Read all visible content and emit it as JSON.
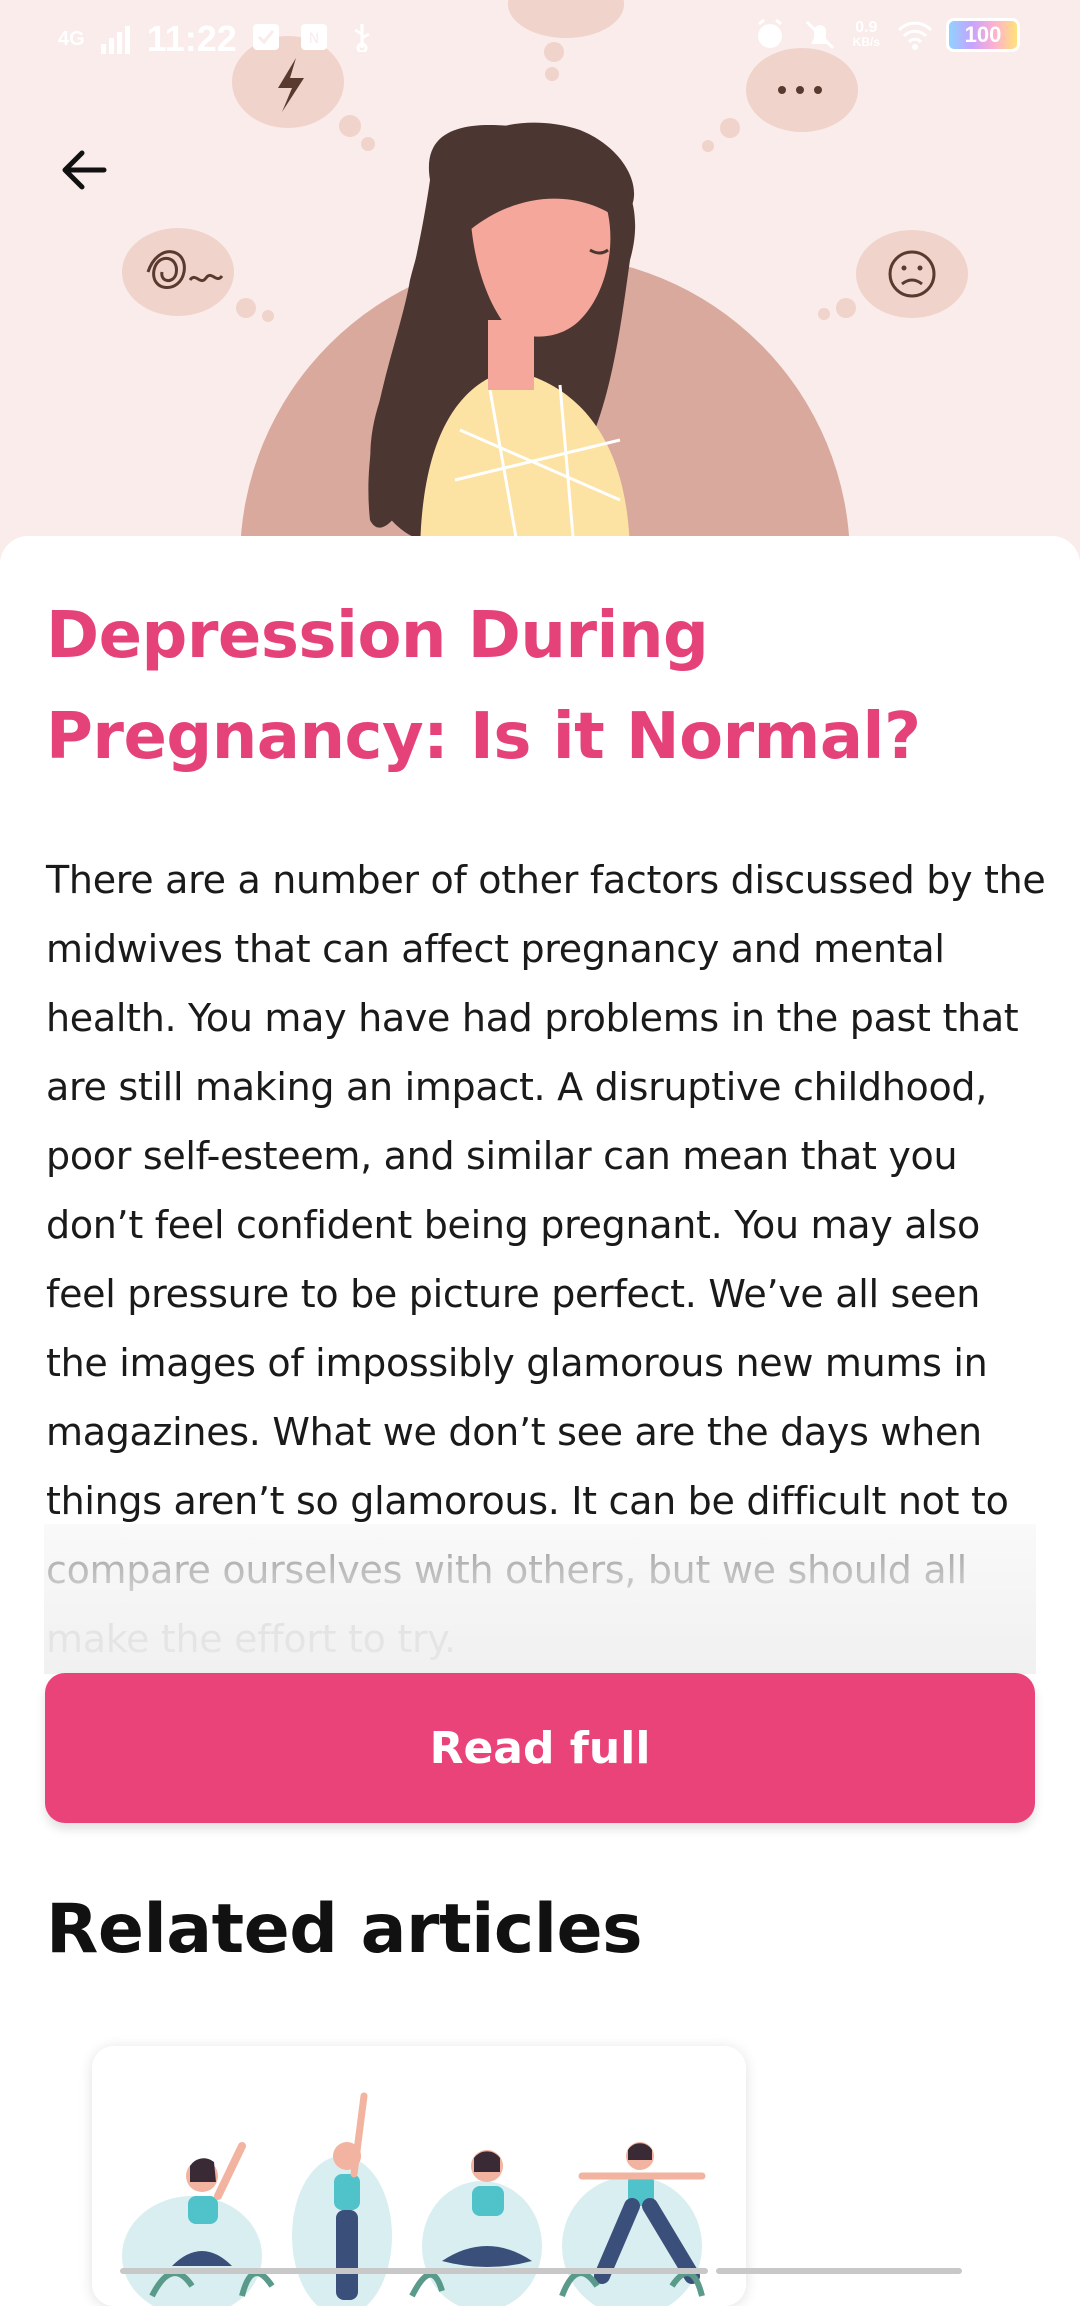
{
  "status_bar": {
    "network": "4G",
    "time": "11:22",
    "speed_value": "0.9",
    "speed_unit": "KB/s",
    "battery": "100"
  },
  "icons": {
    "back": "arrow-left-icon",
    "alarm": "alarm-icon",
    "mute": "bell-off-icon",
    "wifi": "wifi-icon",
    "battery": "battery-icon"
  },
  "article": {
    "title": "Depression During Pregnancy: Is it Normal?",
    "body": "There are a number of other factors discussed by the midwives that can affect pregnancy and mental health. You may have had problems in the past that are still making an impact. A disruptive childhood, poor self-esteem, and similar can mean that you don’t feel confident being pregnant.  You may also feel pressure to be picture perfect. We’ve all seen the images of impossibly glamorous new mums in magazines. What we don’t see are the days when things aren’t so glamorous. It can be difficult not to compare ourselves with others, but we should all make the effort to try.",
    "read_full_label": "Read full"
  },
  "related": {
    "heading": "Related articles"
  },
  "colors": {
    "accent": "#e9437a",
    "title": "#e6427a",
    "hero_bg": "#f9ecea"
  }
}
